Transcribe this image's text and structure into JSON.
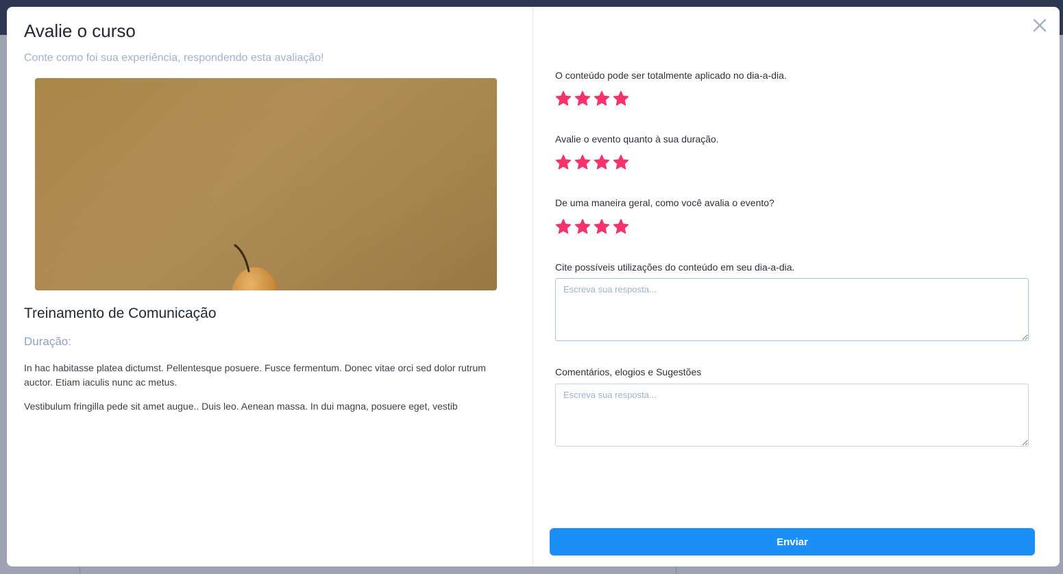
{
  "modal": {
    "title": "Avalie o curso",
    "subtitle": "Conte como foi sua experiência, respondendo esta avaliação!",
    "close_icon": "close-icon"
  },
  "course": {
    "image_icon": "pear-photo",
    "title": "Treinamento de Comunicação",
    "duration_label": "Duração:",
    "description": [
      "In hac habitasse platea dictumst. Pellentesque posuere. Fusce fermentum. Donec vitae orci sed dolor rutrum auctor. Etiam iaculis nunc ac metus.",
      "Vestibulum fringilla pede sit amet augue.. Duis leo. Aenean massa. In dui magna, posuere eget, vestib"
    ]
  },
  "rating_questions": [
    {
      "label": "O conteúdo pode ser totalmente aplicado no dia-a-dia.",
      "stars_filled": 4
    },
    {
      "label": "Avalie o evento quanto à sua duração.",
      "stars_filled": 4
    },
    {
      "label": "De uma maneira geral, como você avalia o evento?",
      "stars_filled": 4
    }
  ],
  "text_questions": [
    {
      "label": "Cite possíveis utilizações do conteúdo em seu dia-a-dia.",
      "value": "",
      "placeholder": "Escreva sua resposta..."
    },
    {
      "label": "Comentários, elogios e Sugestões",
      "value": "",
      "placeholder": "Escreva sua resposta..."
    }
  ],
  "submit_label": "Enviar",
  "colors": {
    "star": "#f4336b",
    "primary": "#1b8ef8",
    "subtitle": "#9fb1cf",
    "title": "#222833"
  }
}
